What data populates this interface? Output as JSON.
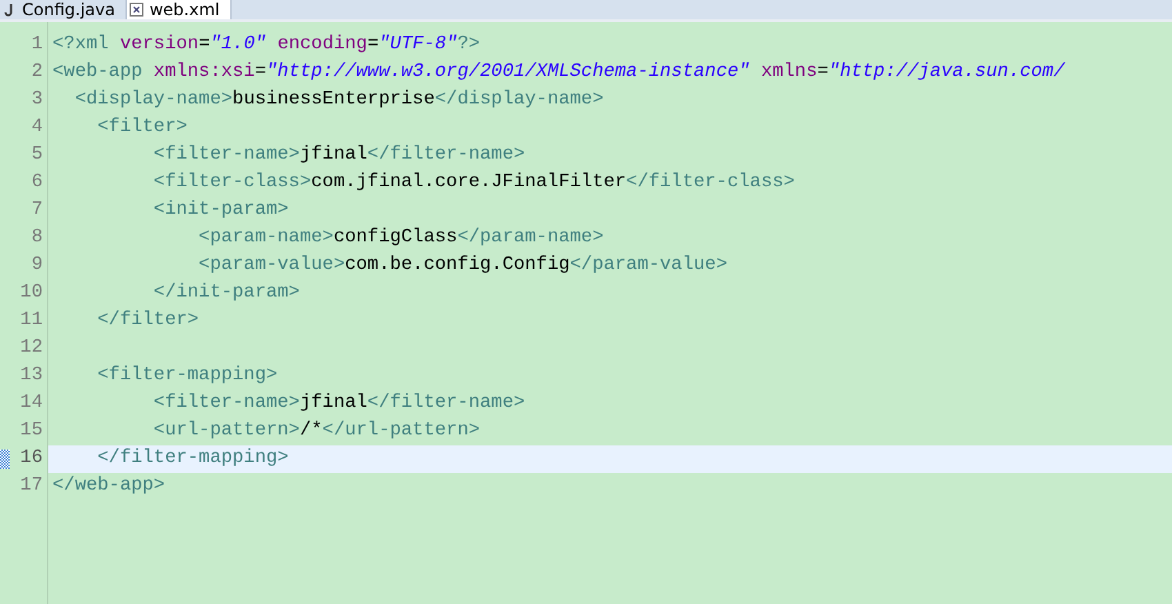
{
  "tabs": [
    {
      "label": "Config.java",
      "kind": "java",
      "selected": false
    },
    {
      "label": "web.xml",
      "kind": "xml",
      "selected": true
    }
  ],
  "editor": {
    "lines": [
      {
        "number": "1",
        "current": false,
        "tokens": [
          {
            "kind": "tag",
            "text": "<?xml "
          },
          {
            "kind": "attr",
            "text": "version"
          },
          {
            "kind": "plain",
            "text": "="
          },
          {
            "kind": "value",
            "text": "\"1.0\""
          },
          {
            "kind": "attr",
            "text": " encoding"
          },
          {
            "kind": "plain",
            "text": "="
          },
          {
            "kind": "value",
            "text": "\"UTF-8\""
          },
          {
            "kind": "tag",
            "text": "?>"
          }
        ]
      },
      {
        "number": "2",
        "current": false,
        "tokens": [
          {
            "kind": "tag",
            "text": "<web-app "
          },
          {
            "kind": "attr",
            "text": "xmlns:xsi"
          },
          {
            "kind": "plain",
            "text": "="
          },
          {
            "kind": "value",
            "text": "\"http://www.w3.org/2001/XMLSchema-instance\""
          },
          {
            "kind": "attr",
            "text": " xmlns"
          },
          {
            "kind": "plain",
            "text": "="
          },
          {
            "kind": "value",
            "text": "\"http://java.sun.com/"
          }
        ]
      },
      {
        "number": "3",
        "current": false,
        "tokens": [
          {
            "kind": "tag",
            "text": "  <display-name>"
          },
          {
            "kind": "text",
            "text": "businessEnterprise"
          },
          {
            "kind": "tag",
            "text": "</display-name>"
          }
        ]
      },
      {
        "number": "4",
        "current": false,
        "tokens": [
          {
            "kind": "tag",
            "text": "    <filter>"
          }
        ]
      },
      {
        "number": "5",
        "current": false,
        "tokens": [
          {
            "kind": "tag",
            "text": "         <filter-name>"
          },
          {
            "kind": "text",
            "text": "jfinal"
          },
          {
            "kind": "tag",
            "text": "</filter-name>"
          }
        ]
      },
      {
        "number": "6",
        "current": false,
        "tokens": [
          {
            "kind": "tag",
            "text": "         <filter-class>"
          },
          {
            "kind": "text",
            "text": "com.jfinal.core.JFinalFilter"
          },
          {
            "kind": "tag",
            "text": "</filter-class>"
          }
        ]
      },
      {
        "number": "7",
        "current": false,
        "tokens": [
          {
            "kind": "tag",
            "text": "         <init-param>"
          }
        ]
      },
      {
        "number": "8",
        "current": false,
        "tokens": [
          {
            "kind": "tag",
            "text": "             <param-name>"
          },
          {
            "kind": "text",
            "text": "configClass"
          },
          {
            "kind": "tag",
            "text": "</param-name>"
          }
        ]
      },
      {
        "number": "9",
        "current": false,
        "tokens": [
          {
            "kind": "tag",
            "text": "             <param-value>"
          },
          {
            "kind": "text",
            "text": "com.be.config.Config"
          },
          {
            "kind": "tag",
            "text": "</param-value>"
          }
        ]
      },
      {
        "number": "10",
        "current": false,
        "tokens": [
          {
            "kind": "tag",
            "text": "         </init-param>"
          }
        ]
      },
      {
        "number": "11",
        "current": false,
        "tokens": [
          {
            "kind": "tag",
            "text": "    </filter>"
          }
        ]
      },
      {
        "number": "12",
        "current": false
      },
      {
        "number": "13",
        "current": false,
        "tokens": [
          {
            "kind": "tag",
            "text": "    <filter-mapping>"
          }
        ]
      },
      {
        "number": "14",
        "current": false,
        "tokens": [
          {
            "kind": "tag",
            "text": "         <filter-name>"
          },
          {
            "kind": "text",
            "text": "jfinal"
          },
          {
            "kind": "tag",
            "text": "</filter-name>"
          }
        ]
      },
      {
        "number": "15",
        "current": false,
        "tokens": [
          {
            "kind": "tag",
            "text": "         <url-pattern>"
          },
          {
            "kind": "text",
            "text": "/*"
          },
          {
            "kind": "tag",
            "text": "</url-pattern>"
          }
        ]
      },
      {
        "number": "16",
        "current": true,
        "tokens": [
          {
            "kind": "tag",
            "text": "    </filter-mapping>"
          }
        ]
      },
      {
        "number": "17",
        "current": false,
        "tokens": [
          {
            "kind": "tag",
            "text": "</web-app>"
          }
        ]
      }
    ]
  }
}
